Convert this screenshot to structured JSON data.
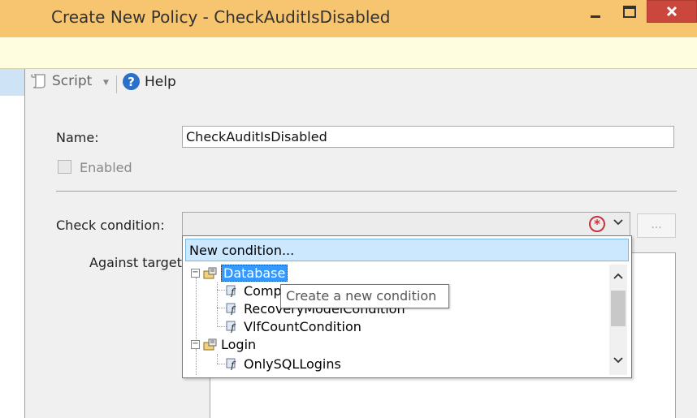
{
  "window": {
    "title": "Create New Policy - CheckAuditIsDisabled"
  },
  "toolbar": {
    "script_label": "Script",
    "help_label": "Help",
    "help_icon_glyph": "?"
  },
  "form": {
    "name_label": "Name:",
    "name_value": "CheckAuditIsDisabled",
    "enabled_label": "Enabled",
    "enabled_checked": false,
    "check_condition_label": "Check condition:",
    "check_condition_value": "",
    "ellipsis_label": "...",
    "against_targets_label": "Against targets"
  },
  "dropdown": {
    "new_condition_label": "New condition...",
    "tree": {
      "database_label": "Database",
      "database_children": [
        "CompatibilityLevelCondition",
        "RecoveryModelCondition",
        "VlfCountCondition"
      ],
      "login_label": "Login",
      "login_children": [
        "OnlySQLLogins"
      ]
    }
  },
  "tooltip": {
    "text": "Create a new condition"
  },
  "icons": {
    "script": "script-icon",
    "help": "help-icon",
    "error": "required-error-icon",
    "facet": "facet-icon",
    "condition": "condition-icon"
  },
  "colors": {
    "title_bar": "#f7c56f",
    "info_bar": "#fffde0",
    "close_button": "#c9473c",
    "selection": "#3399ff",
    "highlight": "#cce8ff",
    "error": "#c8323d"
  }
}
